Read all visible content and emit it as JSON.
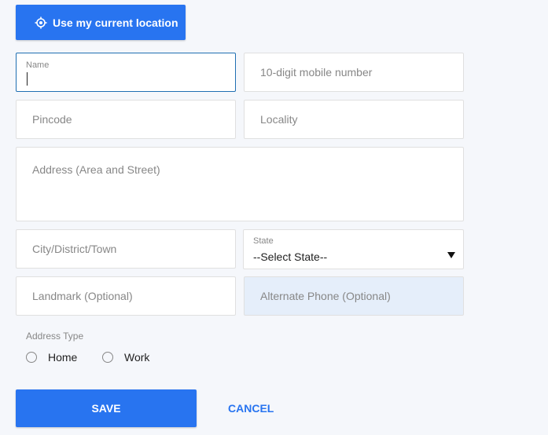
{
  "location_button": {
    "label": "Use my current location",
    "icon": "gps-crosshair-icon"
  },
  "fields": {
    "name": {
      "label": "Name",
      "value": ""
    },
    "mobile": {
      "placeholder": "10-digit mobile number"
    },
    "pincode": {
      "placeholder": "Pincode"
    },
    "locality": {
      "placeholder": "Locality"
    },
    "address": {
      "placeholder": "Address (Area and Street)"
    },
    "city": {
      "placeholder": "City/District/Town"
    },
    "state": {
      "label": "State",
      "selected": "--Select State--"
    },
    "landmark": {
      "placeholder": "Landmark (Optional)"
    },
    "alt_phone": {
      "placeholder": "Alternate Phone (Optional)"
    }
  },
  "address_type": {
    "label": "Address Type",
    "options": [
      "Home",
      "Work"
    ]
  },
  "actions": {
    "save": "SAVE",
    "cancel": "CANCEL"
  },
  "colors": {
    "accent": "#2874f0",
    "page_bg": "#f5f7fb",
    "alt_field_bg": "#e5eefa"
  }
}
